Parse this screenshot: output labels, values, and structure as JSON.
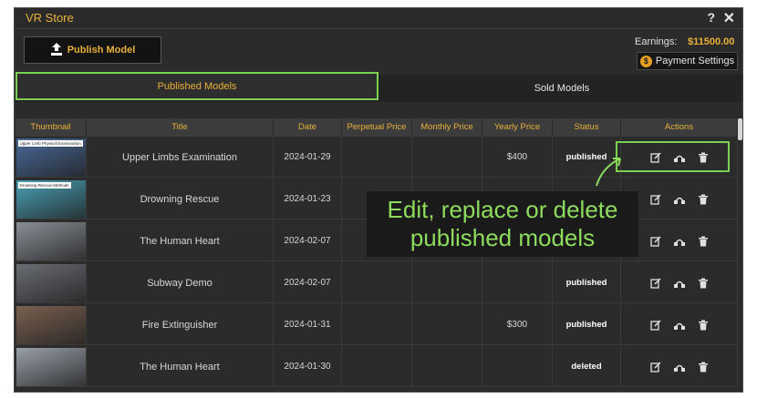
{
  "window": {
    "title": "VR Store",
    "help_label": "?",
    "close_label": "✕"
  },
  "toolbar": {
    "publish_label": "Publish Model"
  },
  "earnings": {
    "label": "Earnings:",
    "value": "$11500.00"
  },
  "payment": {
    "label": "Payment Settings",
    "coin_label": "$"
  },
  "tabs": [
    {
      "label": "Published Models",
      "active": true
    },
    {
      "label": "Sold Models",
      "active": false
    }
  ],
  "table": {
    "headers": [
      "Thumbnail",
      "Title",
      "Date",
      "Perpetual Price",
      "Monthly Price",
      "Yearly Price",
      "Status",
      "Actions"
    ],
    "rows": [
      {
        "thumb_caption": "Upper Limb Physical Examination",
        "title": "Upper Limbs Examination",
        "date": "2024-01-29",
        "perpetual": "",
        "monthly": "",
        "yearly": "$400",
        "status": "published",
        "thumb_color": "#4a6a9a"
      },
      {
        "thumb_caption": "Drowning Rescue Methods",
        "title": "Drowning Rescue",
        "date": "2024-01-23",
        "perpetual": "",
        "monthly": "",
        "yearly": "",
        "status": "",
        "thumb_color": "#4aa0b5"
      },
      {
        "thumb_caption": "",
        "title": "The Human Heart",
        "date": "2024-02-07",
        "perpetual": "",
        "monthly": "",
        "yearly": "",
        "status": "",
        "thumb_color": "#8a8f96"
      },
      {
        "thumb_caption": "",
        "title": "Subway Demo",
        "date": "2024-02-07",
        "perpetual": "",
        "monthly": "",
        "yearly": "",
        "status": "published",
        "thumb_color": "#6a6d72"
      },
      {
        "thumb_caption": "",
        "title": "Fire Extinguisher",
        "date": "2024-01-31",
        "perpetual": "",
        "monthly": "",
        "yearly": "$300",
        "status": "published",
        "thumb_color": "#7a6050"
      },
      {
        "thumb_caption": "",
        "title": "The Human Heart",
        "date": "2024-01-30",
        "perpetual": "",
        "monthly": "",
        "yearly": "",
        "status": "deleted",
        "thumb_color": "#9aa0a8"
      }
    ]
  },
  "annotation": {
    "line1": "Edit, replace or delete",
    "line2": "published models"
  },
  "colors": {
    "accent": "#e8b03a",
    "highlight": "#7cd052"
  },
  "icons": {
    "edit": "edit-icon",
    "replace": "replace-icon",
    "delete": "trash-icon"
  }
}
